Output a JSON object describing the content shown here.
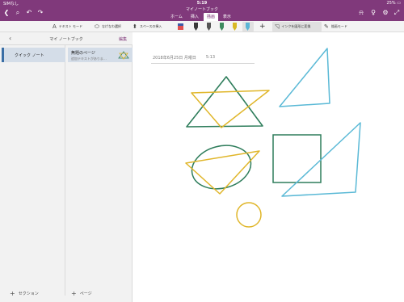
{
  "status_bar": {
    "carrier": "SIMなし",
    "time": "5:19",
    "battery": "25%"
  },
  "app": {
    "title": "マイノートブック"
  },
  "tabs": [
    {
      "label": "ホーム",
      "active": false
    },
    {
      "label": "挿入",
      "active": false
    },
    {
      "label": "描画",
      "active": true
    },
    {
      "label": "表示",
      "active": false
    }
  ],
  "ribbon": {
    "text_mode": "テキスト モード",
    "lasso_select": "なげなわ選択",
    "insert_space": "スペースの挿入",
    "ink_to_shape": "インクを図形に変換",
    "drawing_mode": "描画モード"
  },
  "pen_colors": [
    "#e05050",
    "#3a3a3a",
    "#3d8a5e",
    "#d8b824",
    "#5ab5d6"
  ],
  "sidebar": {
    "notebook_title": "マイ ノートブック",
    "edit_label": "編集",
    "sections": [
      {
        "label": "クイック ノート"
      }
    ],
    "pages": [
      {
        "title": "無題のページ",
        "preview": "追加テキストがありま…"
      }
    ],
    "add_section": "セクション",
    "add_page": "ページ"
  },
  "page": {
    "date": "2018年6月25日 月曜日",
    "time": "5:13"
  },
  "colors": {
    "accent": "#80397b",
    "ink_green": "#2e7d5b",
    "ink_yellow": "#e0b62a",
    "ink_blue": "#5ab9d6"
  }
}
